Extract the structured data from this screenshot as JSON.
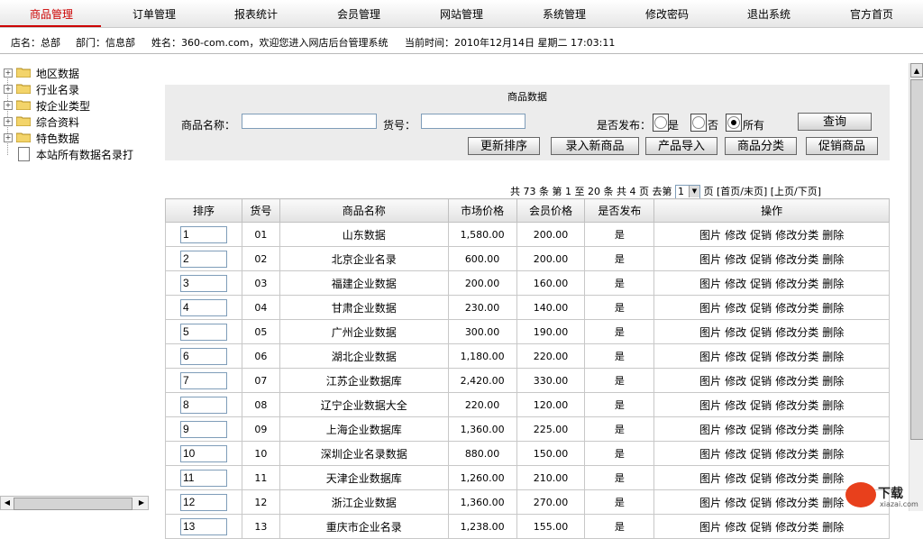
{
  "nav": {
    "items": [
      "商品管理",
      "订单管理",
      "报表统计",
      "会员管理",
      "网站管理",
      "系统管理",
      "修改密码",
      "退出系统",
      "官方首页"
    ],
    "active_index": 0,
    "active_color": "#cc0000"
  },
  "info": {
    "shop": "店名：总部",
    "dept": "部门：信息部",
    "user": "姓名：360-com.com，欢迎您进入网店后台管理系统",
    "time": "当前时间：2010年12月14日 星期二 17:03:11"
  },
  "tree": {
    "items": [
      {
        "label": "地区数据",
        "icon": "folder-icon"
      },
      {
        "label": "行业名录",
        "icon": "folder-icon"
      },
      {
        "label": "按企业类型",
        "icon": "folder-icon"
      },
      {
        "label": "综合资料",
        "icon": "folder-icon"
      },
      {
        "label": "特色数据",
        "icon": "folder-icon"
      },
      {
        "label": "本站所有数据名录打",
        "icon": "document-icon"
      }
    ]
  },
  "search": {
    "title": "商品数据",
    "name_label": "商品名称：",
    "name_value": "",
    "code_label": "货号：",
    "code_value": "",
    "publish_label": "是否发布：",
    "opt_yes": "是",
    "opt_no": "否",
    "opt_all": "所有",
    "selected": "所有",
    "query_button": "查询"
  },
  "actions": [
    "更新排序",
    "录入新商品",
    "产品导入",
    "商品分类",
    "促销商品"
  ],
  "pagination": {
    "text": "共 73 条 第 1 至 20 条 共 4 页  去第",
    "page": "1",
    "suffix": "页 [首页/末页] [上页/下页]"
  },
  "table": {
    "headers": [
      "排序",
      "货号",
      "商品名称",
      "市场价格",
      "会员价格",
      "是否发布",
      "操作"
    ],
    "ops": [
      "图片",
      "修改",
      "促销",
      "修改分类",
      "删除"
    ],
    "rows": [
      {
        "sort": "1",
        "code": "01",
        "name": "山东数据",
        "market": "1,580.00",
        "member": "200.00",
        "pub": "是"
      },
      {
        "sort": "2",
        "code": "02",
        "name": "北京企业名录",
        "market": "600.00",
        "member": "200.00",
        "pub": "是"
      },
      {
        "sort": "3",
        "code": "03",
        "name": "福建企业数据",
        "market": "200.00",
        "member": "160.00",
        "pub": "是"
      },
      {
        "sort": "4",
        "code": "04",
        "name": "甘肃企业数据",
        "market": "230.00",
        "member": "140.00",
        "pub": "是"
      },
      {
        "sort": "5",
        "code": "05",
        "name": "广州企业数据",
        "market": "300.00",
        "member": "190.00",
        "pub": "是"
      },
      {
        "sort": "6",
        "code": "06",
        "name": "湖北企业数据",
        "market": "1,180.00",
        "member": "220.00",
        "pub": "是"
      },
      {
        "sort": "7",
        "code": "07",
        "name": "江苏企业数据库",
        "market": "2,420.00",
        "member": "330.00",
        "pub": "是"
      },
      {
        "sort": "8",
        "code": "08",
        "name": "辽宁企业数据大全",
        "market": "220.00",
        "member": "120.00",
        "pub": "是"
      },
      {
        "sort": "9",
        "code": "09",
        "name": "上海企业数据库",
        "market": "1,360.00",
        "member": "225.00",
        "pub": "是"
      },
      {
        "sort": "10",
        "code": "10",
        "name": "深圳企业名录数据",
        "market": "880.00",
        "member": "150.00",
        "pub": "是"
      },
      {
        "sort": "11",
        "code": "11",
        "name": "天津企业数据库",
        "market": "1,260.00",
        "member": "210.00",
        "pub": "是"
      },
      {
        "sort": "12",
        "code": "12",
        "name": "浙江企业数据",
        "market": "1,360.00",
        "member": "270.00",
        "pub": "是"
      },
      {
        "sort": "13",
        "code": "13",
        "name": "重庆市企业名录",
        "market": "1,238.00",
        "member": "155.00",
        "pub": "是"
      }
    ]
  },
  "watermark": {
    "main": "下载",
    "sub": "xiazai.com"
  }
}
